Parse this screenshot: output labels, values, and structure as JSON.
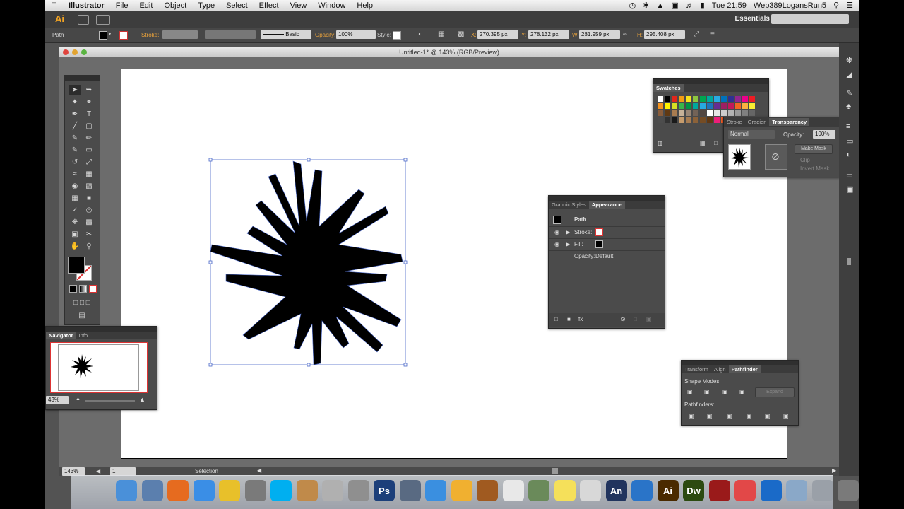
{
  "menubar": {
    "app_name": "Illustrator",
    "items": [
      "File",
      "Edit",
      "Object",
      "Type",
      "Select",
      "Effect",
      "View",
      "Window",
      "Help"
    ],
    "clock": "Tue 21:59",
    "user": "Web389LogansRun5"
  },
  "appbar": {
    "logo": "Ai",
    "workspace": "Essentials"
  },
  "controlbar": {
    "selection_type": "Path",
    "stroke_label": "Stroke:",
    "brush": "Basic",
    "opacity_label": "Opacity:",
    "opacity_value": "100%",
    "style_label": "Style:",
    "x_label": "X:",
    "x_value": "270.395 px",
    "y_label": "Y:",
    "y_value": "278.132 px",
    "w_label": "W:",
    "w_value": "281.959 px",
    "h_label": "H:",
    "h_value": "295.408 px"
  },
  "document": {
    "title": "Untitled-1* @ 143% (RGB/Preview)"
  },
  "navigator": {
    "tabs": [
      "Navigator",
      "Info"
    ],
    "zoom": "43%"
  },
  "swatches": {
    "title": "Swatches"
  },
  "transparency": {
    "tabs": [
      "Stroke",
      "Gradien",
      "Transparency"
    ],
    "blend_mode": "Normal",
    "opacity_label": "Opacity:",
    "opacity_value": "100%",
    "make_mask": "Make Mask",
    "clip": "Clip",
    "invert_mask": "Invert Mask"
  },
  "appearance": {
    "tabs": [
      "Graphic Styles",
      "Appearance"
    ],
    "object": "Path",
    "stroke_label": "Stroke:",
    "fill_label": "Fill:",
    "opacity_label": "Opacity:",
    "opacity_value": "Default"
  },
  "pathfinder": {
    "tabs": [
      "Transform",
      "Align",
      "Pathfinder"
    ],
    "shape_modes": "Shape Modes:",
    "expand": "Expand",
    "pathfinders": "Pathfinders:"
  },
  "statusbar": {
    "zoom": "143%",
    "artboard": "1",
    "tool": "Selection"
  },
  "dock": {
    "apps": [
      "Finder",
      "Preview",
      "Firefox",
      "Safari",
      "Chrome",
      "System Preferences",
      "Skype",
      "Pixelmator",
      "Scissors",
      "Font Book",
      "Ps",
      "Launchpad",
      "App Store",
      "Photos",
      "GarageBand",
      "TextEdit",
      "Grapher",
      "Stickies",
      "Notes",
      "An",
      "QuickTime",
      "Ai",
      "Dw",
      "Photo Booth",
      "Lifesaver",
      "Xcode",
      "Downloads",
      "Help",
      "Trash"
    ]
  },
  "colors": {
    "accent_orange": "#e9a23b",
    "panel_bg": "#4b4b4b",
    "selection_blue": "#4a68c9"
  }
}
